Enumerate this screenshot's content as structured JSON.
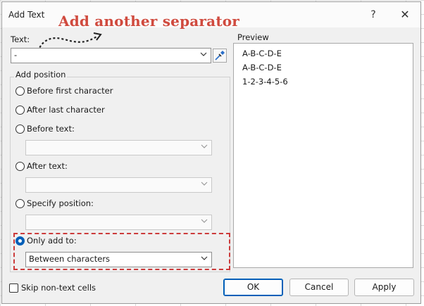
{
  "window": {
    "title": "Add Text",
    "help_glyph": "?",
    "close_glyph": "✕"
  },
  "annotation": {
    "text": "Add another separator",
    "color": "#d04a3e"
  },
  "text_field": {
    "label": "Text:",
    "value": "-"
  },
  "add_position": {
    "group_label": "Add position",
    "options": [
      {
        "label": "Before first character",
        "checked": false
      },
      {
        "label": "After last character",
        "checked": false
      },
      {
        "label": "Before text:",
        "checked": false
      },
      {
        "label": "After text:",
        "checked": false
      },
      {
        "label": "Specify position:",
        "checked": false
      },
      {
        "label": "Only add to:",
        "checked": true
      }
    ],
    "only_add_to_value": "Between characters"
  },
  "preview": {
    "label": "Preview",
    "lines": [
      "A-B-C-D-E",
      "A-B-C-D-E",
      "1-2-3-4-5-6"
    ]
  },
  "skip_non_text": {
    "label": "Skip non-text cells",
    "checked": false
  },
  "buttons": {
    "ok": "OK",
    "cancel": "Cancel",
    "apply": "Apply"
  },
  "colors": {
    "accent": "#005fb8",
    "highlight_dash": "#cc3b3b"
  }
}
